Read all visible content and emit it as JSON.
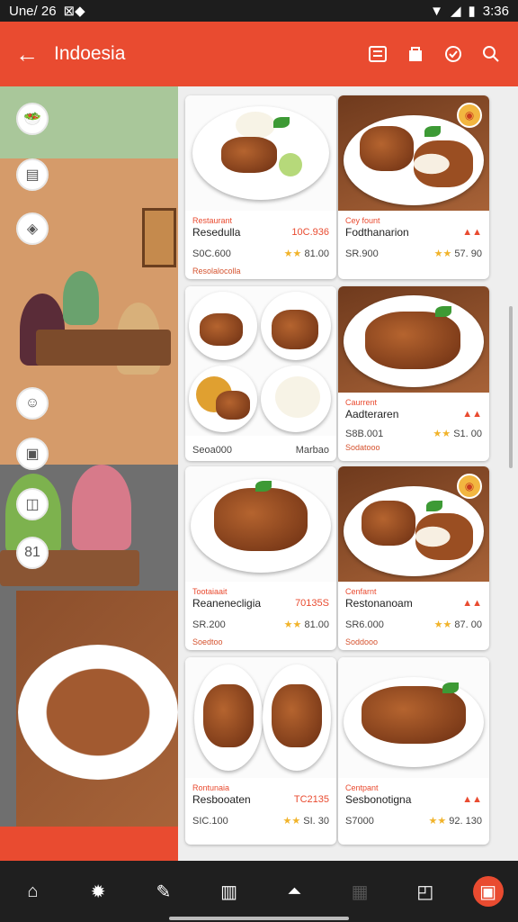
{
  "status_bar": {
    "time_left": "Une/ 26",
    "extra": "⊠◆",
    "time_right": "3:36"
  },
  "app_bar": {
    "title": "Indoesia",
    "back_icon": "arrow-left-icon"
  },
  "side_icons": [
    "salad-icon",
    "menu-card-icon",
    "leaf-icon",
    "person-icon",
    "document-icon",
    "save-icon",
    "number-icon"
  ],
  "cards": [
    {
      "cat": "Restaurant",
      "name": "Resedulla",
      "price": "10C.936",
      "meta_left": "S0C.600",
      "stars": "★★",
      "meta_right": "81.00",
      "sub": "Resolalocolla",
      "img": "white"
    },
    {
      "cat": "Cey fount",
      "name": "Fodthanarion",
      "price": "▲▲",
      "meta_left": "SR.900",
      "stars": "★★",
      "meta_right": "57. 90",
      "sub": "",
      "img": "wood",
      "badge": true
    },
    {
      "cat": "",
      "name": "",
      "price": "",
      "meta_left": "Seoa000",
      "stars": "",
      "meta_right": "Marbao",
      "sub": "",
      "img": "white"
    },
    {
      "cat": "Caurrent",
      "name": "Aadteraren",
      "price": "▲▲",
      "meta_left": "S8B.001",
      "stars": "★★",
      "meta_right": "S1. 00",
      "sub": "Sodatooo",
      "img": "wood"
    },
    {
      "cat": "Tootaiaait",
      "name": "Reanenecligia",
      "price": "70135S",
      "meta_left": "SR.200",
      "stars": "★★",
      "meta_right": "81.00",
      "sub": "Soedtoo",
      "img": "white"
    },
    {
      "cat": "Cenfarnt",
      "name": "Restonanoam",
      "price": "▲▲",
      "meta_left": "SR6.000",
      "stars": "★★",
      "meta_right": "87. 00",
      "sub": "Soddooo",
      "img": "wood",
      "badge": true
    },
    {
      "cat": "Rontunaia",
      "name": "Resbooaten",
      "price": "TC2135",
      "meta_left": "SIC.100",
      "stars": "★★",
      "meta_right": "SI. 30",
      "sub": "",
      "img": "white"
    },
    {
      "cat": "Centpant",
      "name": "Sesbonotigna",
      "price": "▲▲",
      "meta_left": "S7000",
      "stars": "★★",
      "meta_right": "92. 130",
      "sub": "",
      "img": "white"
    }
  ],
  "bottom_nav": [
    "home-icon",
    "spark-icon",
    "pen-icon",
    "chart-icon",
    "bell-icon",
    "grid-icon",
    "cart-icon",
    "active-menu-icon"
  ]
}
